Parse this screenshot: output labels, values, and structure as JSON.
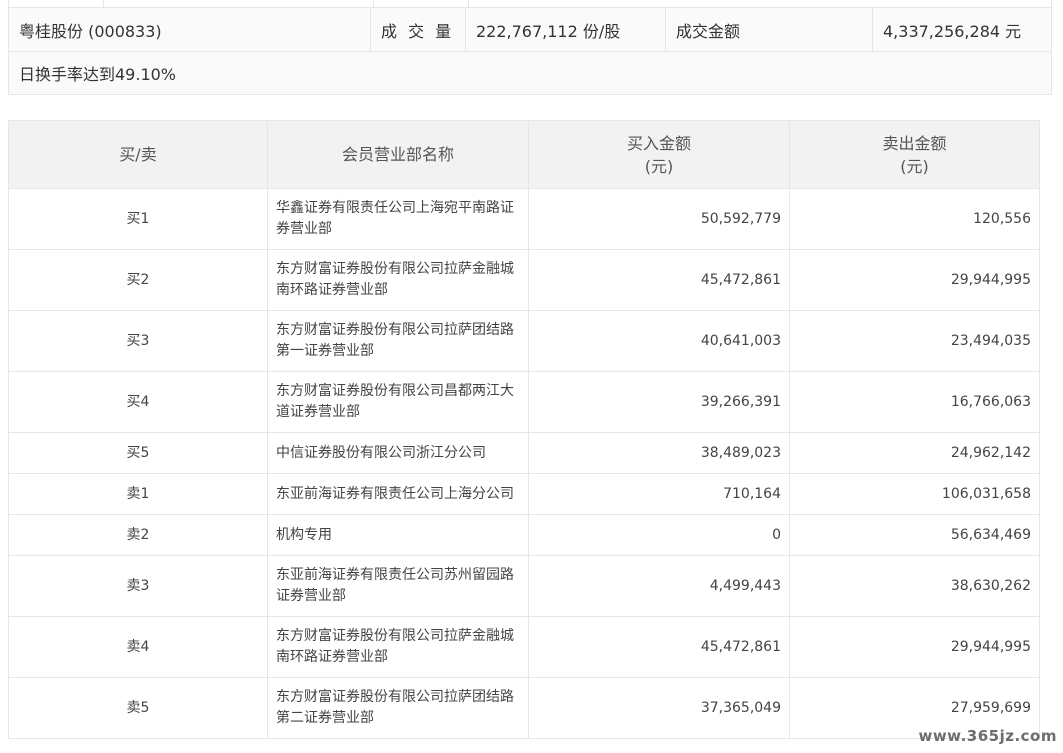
{
  "summary": {
    "stock": "粤桂股份 (000833)",
    "volume_label": "成 交 量",
    "volume_value": "222,767,112 份/股",
    "amount_label": "成交金额",
    "amount_value": "4,337,256,284 元",
    "turnover_text": "日换手率达到49.10%"
  },
  "table": {
    "headers": {
      "side": "买/卖",
      "dept": "会员营业部名称",
      "buy_line1": "买入金额",
      "buy_line2": "(元)",
      "sell_line1": "卖出金额",
      "sell_line2": "(元)"
    },
    "rows": [
      {
        "side": "买1",
        "dept": "华鑫证券有限责任公司上海宛平南路证券营业部",
        "buy": "50,592,779",
        "sell": "120,556"
      },
      {
        "side": "买2",
        "dept": "东方财富证券股份有限公司拉萨金融城南环路证券营业部",
        "buy": "45,472,861",
        "sell": "29,944,995"
      },
      {
        "side": "买3",
        "dept": "东方财富证券股份有限公司拉萨团结路第一证券营业部",
        "buy": "40,641,003",
        "sell": "23,494,035"
      },
      {
        "side": "买4",
        "dept": "东方财富证券股份有限公司昌都两江大道证券营业部",
        "buy": "39,266,391",
        "sell": "16,766,063"
      },
      {
        "side": "买5",
        "dept": "中信证券股份有限公司浙江分公司",
        "buy": "38,489,023",
        "sell": "24,962,142"
      },
      {
        "side": "卖1",
        "dept": "东亚前海证券有限责任公司上海分公司",
        "buy": "710,164",
        "sell": "106,031,658"
      },
      {
        "side": "卖2",
        "dept": "机构专用",
        "buy": "0",
        "sell": "56,634,469"
      },
      {
        "side": "卖3",
        "dept": "东亚前海证券有限责任公司苏州留园路证券营业部",
        "buy": "4,499,443",
        "sell": "38,630,262"
      },
      {
        "side": "卖4",
        "dept": "东方财富证券股份有限公司拉萨金融城南环路证券营业部",
        "buy": "45,472,861",
        "sell": "29,944,995"
      },
      {
        "side": "卖5",
        "dept": "东方财富证券股份有限公司拉萨团结路第二证券营业部",
        "buy": "37,365,049",
        "sell": "27,959,699"
      }
    ]
  },
  "watermark": "www.365jz.com"
}
